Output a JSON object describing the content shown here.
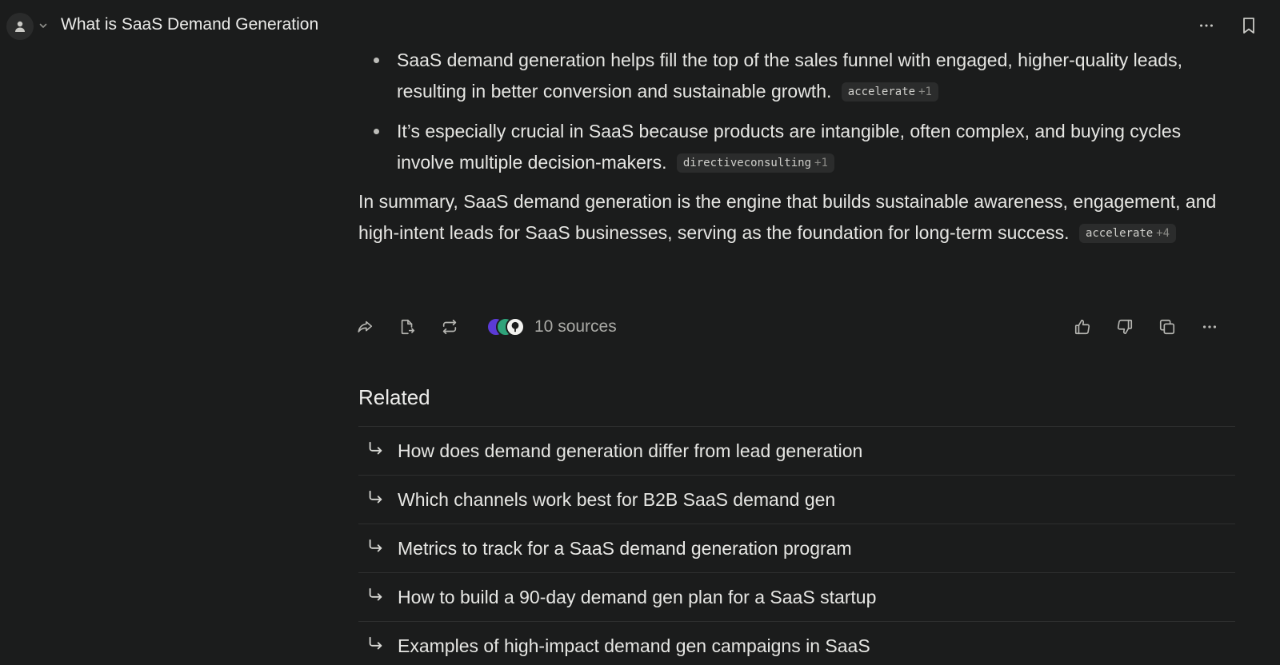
{
  "header": {
    "title": "What is SaaS Demand Generation",
    "avatar_icon": "user-icon",
    "menu_icon": "more-horizontal-icon",
    "bookmark_icon": "bookmark-icon"
  },
  "answer": {
    "bullets": [
      {
        "text": "SaaS demand generation helps fill the top of the sales funnel with engaged, higher-quality leads, resulting in better conversion and sustainable growth.",
        "citation": {
          "label": "accelerate",
          "count": "+1"
        }
      },
      {
        "text": "It’s especially crucial in SaaS because products are intangible, often complex, and buying cycles involve multiple decision-makers.",
        "citation": {
          "label": "directiveconsulting",
          "count": "+1"
        }
      }
    ],
    "summary": {
      "text": "In summary, SaaS demand generation is the engine that builds sustainable awareness, engagement, and high-intent leads for SaaS businesses, serving as the foundation for long-term success.",
      "citation": {
        "label": "accelerate",
        "count": "+4"
      }
    }
  },
  "actions": {
    "share_icon": "share-icon",
    "export_icon": "export-file-icon",
    "rewrite_icon": "rewrite-icon",
    "sources_label": "10 sources",
    "thumbs_up_icon": "thumbs-up-icon",
    "thumbs_down_icon": "thumbs-down-icon",
    "copy_icon": "copy-icon",
    "more_icon": "more-horizontal-icon"
  },
  "related": {
    "title": "Related",
    "items": [
      {
        "text": "How does demand generation differ from lead generation"
      },
      {
        "text": "Which channels work best for B2B SaaS demand gen"
      },
      {
        "text": "Metrics to track for a SaaS demand generation program"
      },
      {
        "text": "How to build a 90-day demand gen plan for a SaaS startup"
      },
      {
        "text": "Examples of high-impact demand gen campaigns in SaaS"
      }
    ]
  },
  "colors": {
    "background": "#1b1c1c",
    "text": "#e6e6e3",
    "chip_bg": "#2b2c2c",
    "muted": "#a9a9a5"
  }
}
